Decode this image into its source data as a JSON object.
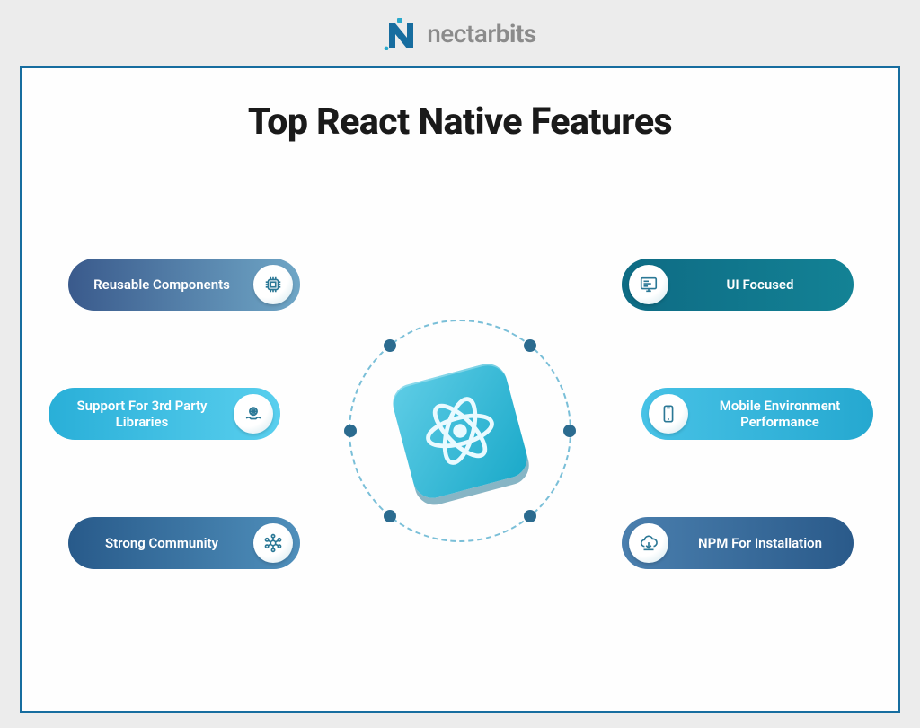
{
  "brand": {
    "name_prefix": "nectar",
    "name_suffix": "bits"
  },
  "title": "Top React Native Features",
  "center": {
    "name": "React Native"
  },
  "features": {
    "left": [
      {
        "label": "Reusable Components",
        "icon": "chip-icon"
      },
      {
        "label": "Support For 3rd Party Libraries",
        "icon": "hands-globe-icon"
      },
      {
        "label": "Strong Community",
        "icon": "network-icon"
      }
    ],
    "right": [
      {
        "label": "UI Focused",
        "icon": "monitor-icon"
      },
      {
        "label": "Mobile Environment Performance",
        "icon": "phone-icon"
      },
      {
        "label": "NPM For Installation",
        "icon": "cloud-download-icon"
      }
    ]
  },
  "colors": {
    "panel_border": "#176d9f",
    "accent": "#2aa9cc",
    "orbit": "#7abfd8"
  }
}
